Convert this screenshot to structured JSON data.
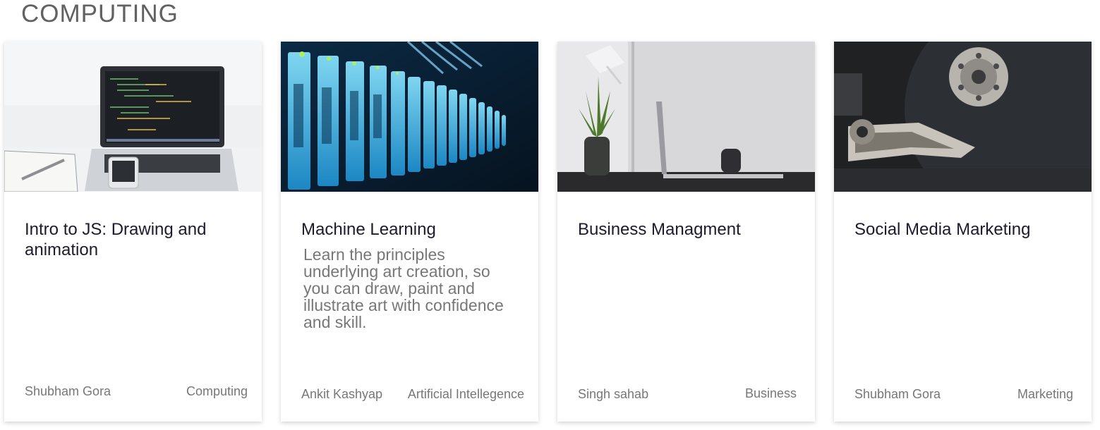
{
  "section": {
    "title": "COMPUTING"
  },
  "cards": [
    {
      "title": "Intro to JS: Drawing and animation",
      "description": "",
      "author": "Shubham Gora",
      "category": "Computing",
      "image": "laptop-code-photo"
    },
    {
      "title": "Machine Learning",
      "description": "Learn the principles underlying art creation, so you can draw, paint and illustrate art with confidence and skill.",
      "author": "Ankit Kashyap",
      "category": "Artificial Intellegence",
      "image": "server-rack-photo"
    },
    {
      "title": "Business Managment",
      "description": "",
      "author": "Singh sahab",
      "category": "Business",
      "image": "desk-workspace-photo"
    },
    {
      "title": "Social Media Marketing",
      "description": "",
      "author": "Shubham Gora",
      "category": "Marketing",
      "image": "hard-drive-photo"
    }
  ]
}
